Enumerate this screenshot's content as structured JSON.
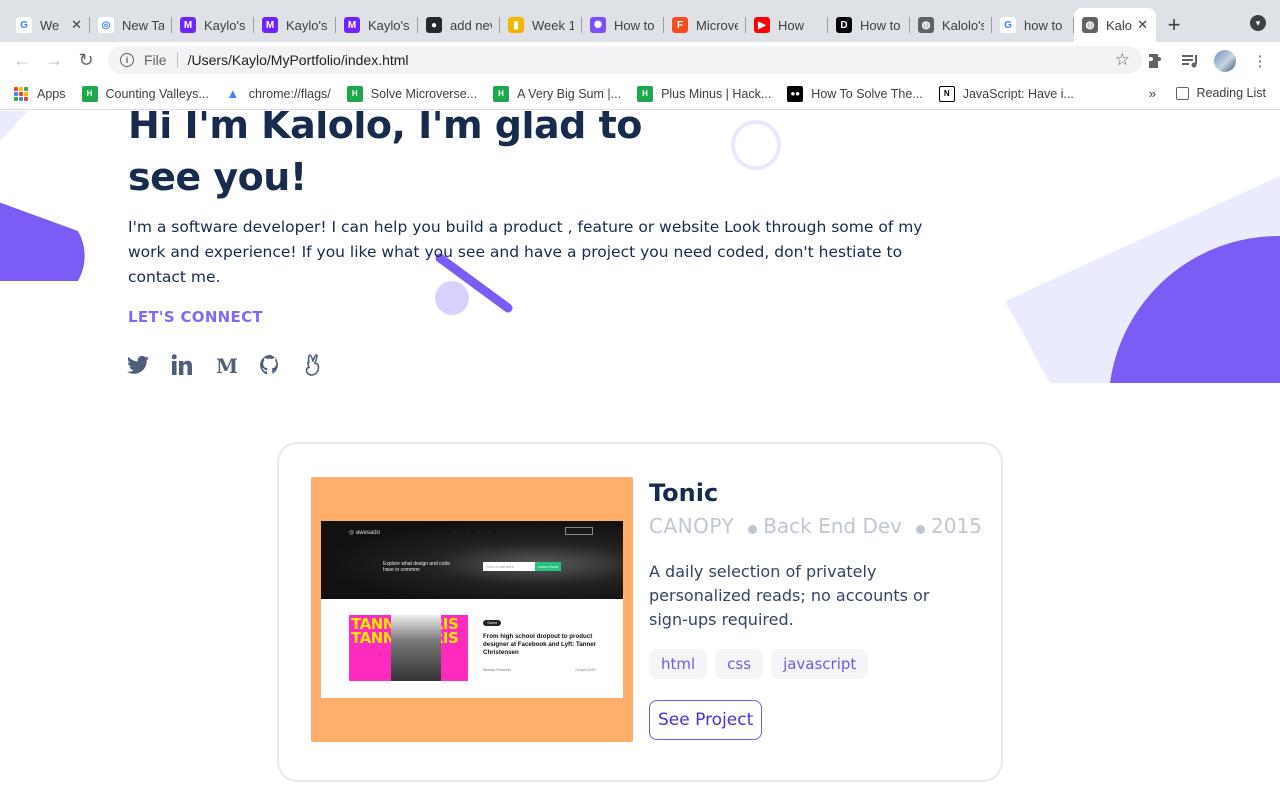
{
  "browser": {
    "tabs": [
      {
        "title": "We",
        "favicon": "google-icon",
        "color": "#ffffff",
        "closable": true
      },
      {
        "title": "New Ta",
        "favicon": "chrome-icon",
        "color": "#ffffff"
      },
      {
        "title": "Kaylo's",
        "favicon": "microverse-icon",
        "color": "#6f23ff"
      },
      {
        "title": "Kaylo's",
        "favicon": "microverse-icon",
        "color": "#6f23ff"
      },
      {
        "title": "Kaylo's",
        "favicon": "microverse-icon",
        "color": "#6f23ff"
      },
      {
        "title": "add nev",
        "favicon": "github-icon",
        "color": "#24292e"
      },
      {
        "title": "Week 1",
        "favicon": "google-slides-icon",
        "color": "#f4b400"
      },
      {
        "title": "How to",
        "favicon": "gear-flower-icon",
        "color": "#7c4dff"
      },
      {
        "title": "Microve",
        "favicon": "figma-icon",
        "color": "#f24e1e"
      },
      {
        "title": "How",
        "favicon": "youtube-icon",
        "color": "#ff0000"
      },
      {
        "title": "How to",
        "favicon": "dev-icon",
        "color": "#000000"
      },
      {
        "title": "Kalolo's",
        "favicon": "globe-icon",
        "color": "#5f6368"
      },
      {
        "title": "how to",
        "favicon": "google-icon",
        "color": "#ffffff"
      },
      {
        "title": "Kalo",
        "favicon": "globe-icon",
        "color": "#5f6368",
        "active": true
      }
    ],
    "url_scheme": "File",
    "url": "/Users/Kaylo/MyPortfolio/index.html",
    "bookmarks": [
      {
        "label": "Apps",
        "icon": "apps-grid-icon"
      },
      {
        "label": "Counting Valleys...",
        "icon": "hackerrank-icon",
        "color": "#1ba94c"
      },
      {
        "label": "chrome://flags/",
        "icon": "flask-icon",
        "color": "#4285f4"
      },
      {
        "label": "Solve Microverse...",
        "icon": "hackerrank-icon",
        "color": "#1ba94c"
      },
      {
        "label": "A Very Big Sum |...",
        "icon": "hackerrank-icon",
        "color": "#1ba94c"
      },
      {
        "label": "Plus Minus | Hack...",
        "icon": "hackerrank-icon",
        "color": "#1ba94c"
      },
      {
        "label": "How To Solve The...",
        "icon": "medium-icon",
        "color": "#000000"
      },
      {
        "label": "JavaScript: Have i...",
        "icon": "notion-icon",
        "color": "#000000"
      }
    ],
    "bookmarks_more": "»",
    "reading_list": "Reading List"
  },
  "hero": {
    "title": "Hi I'm Kalolo, I'm glad to see you!",
    "text": "I'm a software developer! I can help you build a product , feature or website Look through some of my work and experience! If you like what you see and have a project you need coded, don't hestiate to contact me.",
    "connect_label": "LET'S CONNECT",
    "socials": [
      "twitter-icon",
      "linkedin-icon",
      "medium-icon",
      "github-icon",
      "angellist-icon"
    ],
    "icon_color": "#505f79"
  },
  "project": {
    "title": "Tonic",
    "client": "CANOPY",
    "role": "Back End Dev",
    "year": "2015",
    "description": "A daily selection of privately personalized reads; no accounts or sign-ups required.",
    "tags": [
      "html",
      "css",
      "javascript"
    ],
    "button_label": "See Project",
    "thumb_bg": "#ffae6c",
    "preview": {
      "logo": "◎ awesado",
      "nav": "......",
      "headline": "Explore what design and code have in common",
      "input_placeholder": "Your email here",
      "cta": "Learn more",
      "tag": "Guest",
      "article": "From high school dropout to product designer at Facebook and Lyft: Tanner Christensen",
      "author": "Medium Reviewer",
      "date": "24 April 2019",
      "image_text": "TANNE CHRIS TANNE CHRIS"
    }
  },
  "colors": {
    "accent": "#6c5ce7",
    "dark": "#172b4d",
    "lavender": "#ebebff"
  }
}
